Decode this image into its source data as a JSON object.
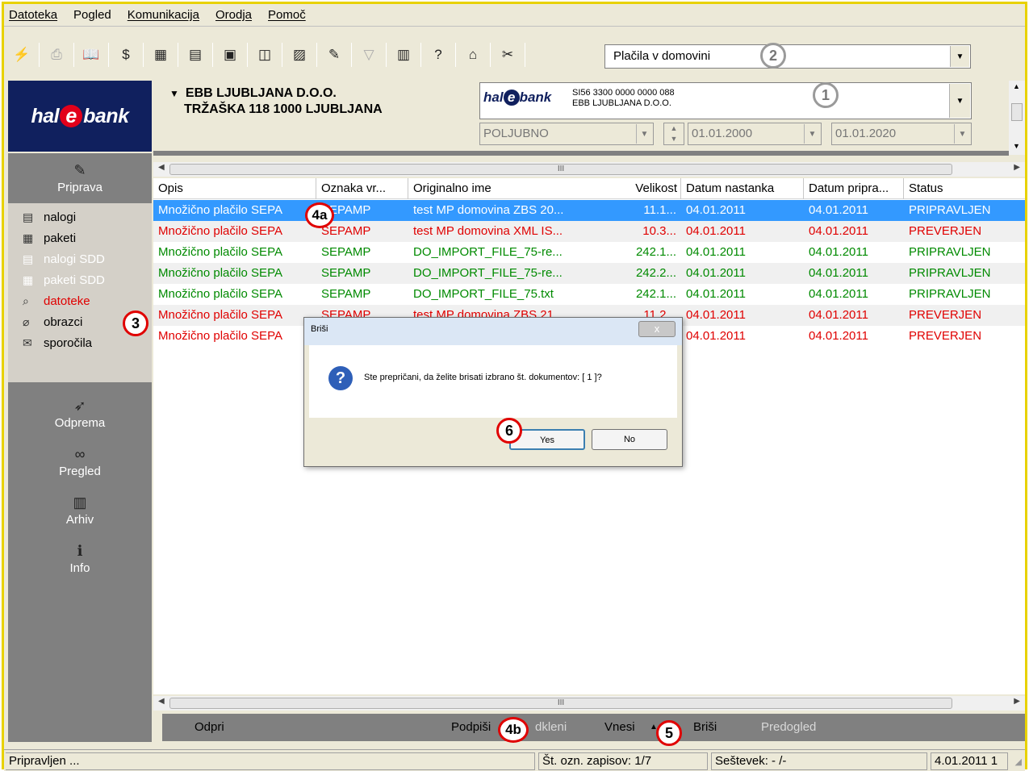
{
  "menu": [
    "Datoteka",
    "Pogled",
    "Komunikacija",
    "Orodja",
    "Pomoč"
  ],
  "toolbar": {
    "account_select_value": "Plačila v domovini"
  },
  "header": {
    "company_line1": "EBB LJUBLJANA D.O.O.",
    "company_line2": "TRŽAŠKA 118 1000 LJUBLJANA",
    "bank_iban": "SI56 3300 0000 0000 088",
    "bank_owner": "EBB LJUBLJANA D.O.O.",
    "bank_logo": "hal e bank",
    "filter_value": "POLJUBNO",
    "date_from": "01.01.2000",
    "date_to": "01.01.2020"
  },
  "logo_text": "hal e bank",
  "sidebar": {
    "priprava": "Priprava",
    "items": [
      {
        "label": "nalogi",
        "icon": "documents-icon",
        "state": "normal"
      },
      {
        "label": "paketi",
        "icon": "package-icon",
        "state": "normal"
      },
      {
        "label": "nalogi SDD",
        "icon": "documents-sdd-icon",
        "state": "disabled"
      },
      {
        "label": "paketi SDD",
        "icon": "package-sdd-icon",
        "state": "disabled"
      },
      {
        "label": "datoteke",
        "icon": "search-icon",
        "state": "active"
      },
      {
        "label": "obrazci",
        "icon": "paperclip-icon",
        "state": "normal"
      },
      {
        "label": "sporočila",
        "icon": "message-icon",
        "state": "normal"
      }
    ],
    "odprema": "Odprema",
    "pregled": "Pregled",
    "arhiv": "Arhiv",
    "info": "Info"
  },
  "grid": {
    "columns": [
      "Opis",
      "Oznaka vr...",
      "Originalno ime",
      "Velikost",
      "Datum nastanka",
      "Datum pripra...",
      "Status"
    ],
    "rows": [
      {
        "opis": "Množično plačilo SEPA",
        "oznaka": "SEPAMP",
        "ime": "test MP domovina ZBS 20...",
        "velikost": "11.1...",
        "nastanek": "04.01.2011",
        "priprava": "04.01.2011",
        "status": "PRIPRAVLJEN",
        "color": "green",
        "selected": true
      },
      {
        "opis": "Množično plačilo SEPA",
        "oznaka": "SEPAMP",
        "ime": "test MP domovina XML IS...",
        "velikost": "10.3...",
        "nastanek": "04.01.2011",
        "priprava": "04.01.2011",
        "status": "PREVERJEN",
        "color": "red",
        "selected": false
      },
      {
        "opis": "Množično plačilo SEPA",
        "oznaka": "SEPAMP",
        "ime": "DO_IMPORT_FILE_75-re...",
        "velikost": "242.1...",
        "nastanek": "04.01.2011",
        "priprava": "04.01.2011",
        "status": "PRIPRAVLJEN",
        "color": "green",
        "selected": false
      },
      {
        "opis": "Množično plačilo SEPA",
        "oznaka": "SEPAMP",
        "ime": "DO_IMPORT_FILE_75-re...",
        "velikost": "242.2...",
        "nastanek": "04.01.2011",
        "priprava": "04.01.2011",
        "status": "PRIPRAVLJEN",
        "color": "green",
        "selected": false
      },
      {
        "opis": "Množično plačilo SEPA",
        "oznaka": "SEPAMP",
        "ime": "DO_IMPORT_FILE_75.txt",
        "velikost": "242.1...",
        "nastanek": "04.01.2011",
        "priprava": "04.01.2011",
        "status": "PRIPRAVLJEN",
        "color": "green",
        "selected": false
      },
      {
        "opis": "Množično plačilo SEPA",
        "oznaka": "SEPAMP",
        "ime": "test MP domovina ZBS 21...",
        "velikost": "11.2...",
        "nastanek": "04.01.2011",
        "priprava": "04.01.2011",
        "status": "PREVERJEN",
        "color": "red",
        "selected": false
      },
      {
        "opis": "Množično plačilo SEPA",
        "oznaka": "",
        "ime": "",
        "velikost": "",
        "nastanek": "04.01.2011",
        "priprava": "04.01.2011",
        "status": "PREVERJEN",
        "color": "red",
        "selected": false
      }
    ]
  },
  "actions": {
    "odpri": "Odpri",
    "podpisi": "Podpiši",
    "odkleni": "dkleni",
    "vnesi": "Vnesi",
    "brisi": "Briši",
    "predogled": "Predogled"
  },
  "status": {
    "state": "Pripravljen ...",
    "count": "Št. ozn. zapisov: 1/7",
    "sum": "Seštevek: - /-",
    "date": "4.01.2011 1"
  },
  "dialog": {
    "title": "Briši",
    "message": "Ste prepričani, da želite brisati izbrano št. dokumentov: [ 1 ]?",
    "yes": "Yes",
    "no": "No",
    "close": "x"
  },
  "callouts": [
    "1",
    "2",
    "3",
    "4a",
    "4b",
    "5",
    "6"
  ],
  "colors": {
    "selection": "#3399ff",
    "green_text": "#008a00",
    "red_text": "#e00000",
    "logo_bg": "#10205e",
    "frame": "#e8d200"
  }
}
